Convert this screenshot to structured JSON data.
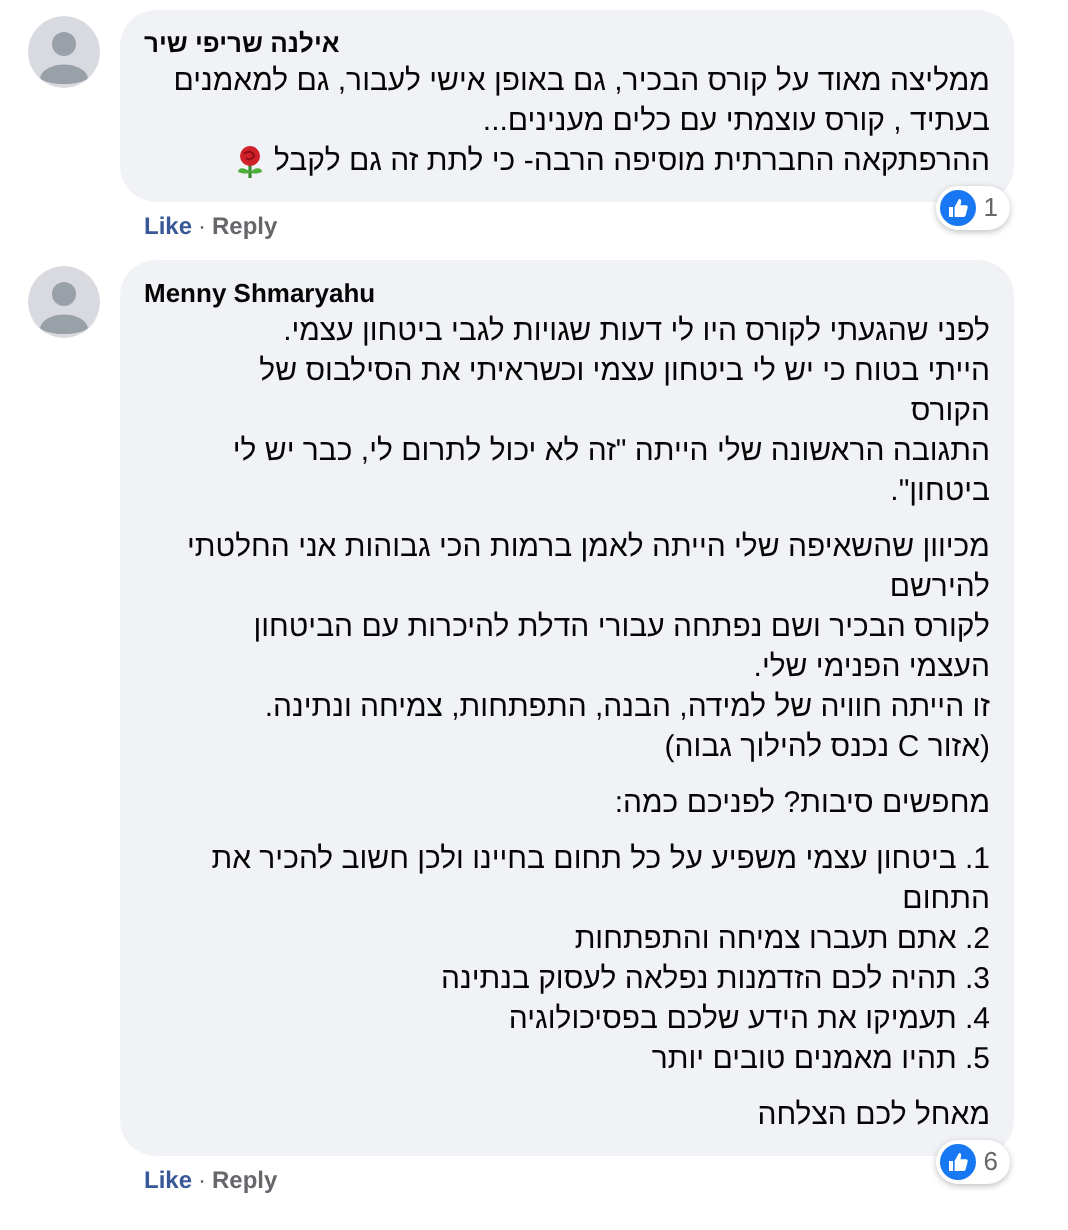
{
  "comments": [
    {
      "author": "אילנה שריפי שיר",
      "paragraphs": [
        {
          "lines": [
            {
              "text": "ממליצה מאוד על קורס הבכיר, גם באופן אישי לעבור, גם למאמנים"
            },
            {
              "text": "בעתיד , קורס עוצמתי עם כלים מענינים..."
            },
            {
              "text": "ההרפתקאה החברתית מוסיפה הרבה- כי לתת זה גם לקבל",
              "rose_emoji": true
            }
          ]
        }
      ],
      "reaction_count": "1",
      "like_link": "Like",
      "separator": "·",
      "reply_link": "Reply"
    },
    {
      "author": "Menny Shmaryahu",
      "paragraphs": [
        {
          "lines": [
            {
              "text": "לפני שהגעתי לקורס היו לי דעות שגויות לגבי ביטחון עצמי."
            },
            {
              "text": "הייתי בטוח כי יש לי ביטחון עצמי וכשראיתי את הסילבוס של"
            },
            {
              "text": "הקורס"
            },
            {
              "text": "התגובה הראשונה שלי הייתה \"זה לא יכול לתרום לי, כבר יש לי"
            },
            {
              "text": "ביטחון\"."
            }
          ]
        },
        {
          "lines": [
            {
              "text": "מכיוון שהשאיפה שלי הייתה לאמן ברמות הכי גבוהות אני החלטתי"
            },
            {
              "text": "להירשם"
            },
            {
              "text": "לקורס הבכיר ושם נפתחה עבורי הדלת להיכרות עם הביטחון"
            },
            {
              "text": "העצמי הפנימי שלי."
            },
            {
              "text": "זו הייתה חוויה של למידה, הבנה, התפתחות, צמיחה ונתינה."
            },
            {
              "text": "(אזור C נכנס להילוך גבוה)"
            }
          ]
        },
        {
          "lines": [
            {
              "text": "מחפשים סיבות? לפניכם כמה:"
            }
          ]
        },
        {
          "lines": [
            {
              "text": "1. ביטחון עצמי משפיע על כל תחום בחיינו ולכן חשוב להכיר את"
            },
            {
              "text": "התחום"
            },
            {
              "text": "2. אתם תעברו צמיחה והתפתחות"
            },
            {
              "text": "3. תהיה לכם הזדמנות נפלאה לעסוק בנתינה"
            },
            {
              "text": "4. תעמיקו את הידע שלכם בפסיכולוגיה"
            },
            {
              "text": "5. תהיו מאמנים טובים יותר"
            }
          ]
        },
        {
          "lines": [
            {
              "text": "מאחל לכם הצלחה"
            }
          ]
        }
      ],
      "reaction_count": "6",
      "like_link": "Like",
      "separator": "·",
      "reply_link": "Reply"
    }
  ]
}
